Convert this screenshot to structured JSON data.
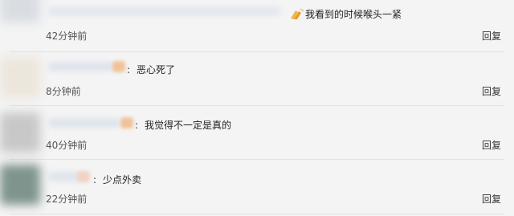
{
  "comments": [
    {
      "text": "我看到的时候喉头一紧",
      "time": "42分钟前",
      "reply_label": "回复",
      "emoji": "clapping-hands-icon"
    },
    {
      "text": "恶心死了",
      "time": "8分钟前",
      "reply_label": "回复",
      "separator": ":"
    },
    {
      "text": "我觉得不一定是真的",
      "time": "40分钟前",
      "reply_label": "回复",
      "separator": ":"
    },
    {
      "text": "少点外卖",
      "time": "22分钟前",
      "reply_label": "回复",
      "separator": ":"
    }
  ],
  "colors": {
    "background": "#f4f4f4",
    "divider": "#e2e2e2",
    "text": "#222222",
    "time": "#555555"
  }
}
